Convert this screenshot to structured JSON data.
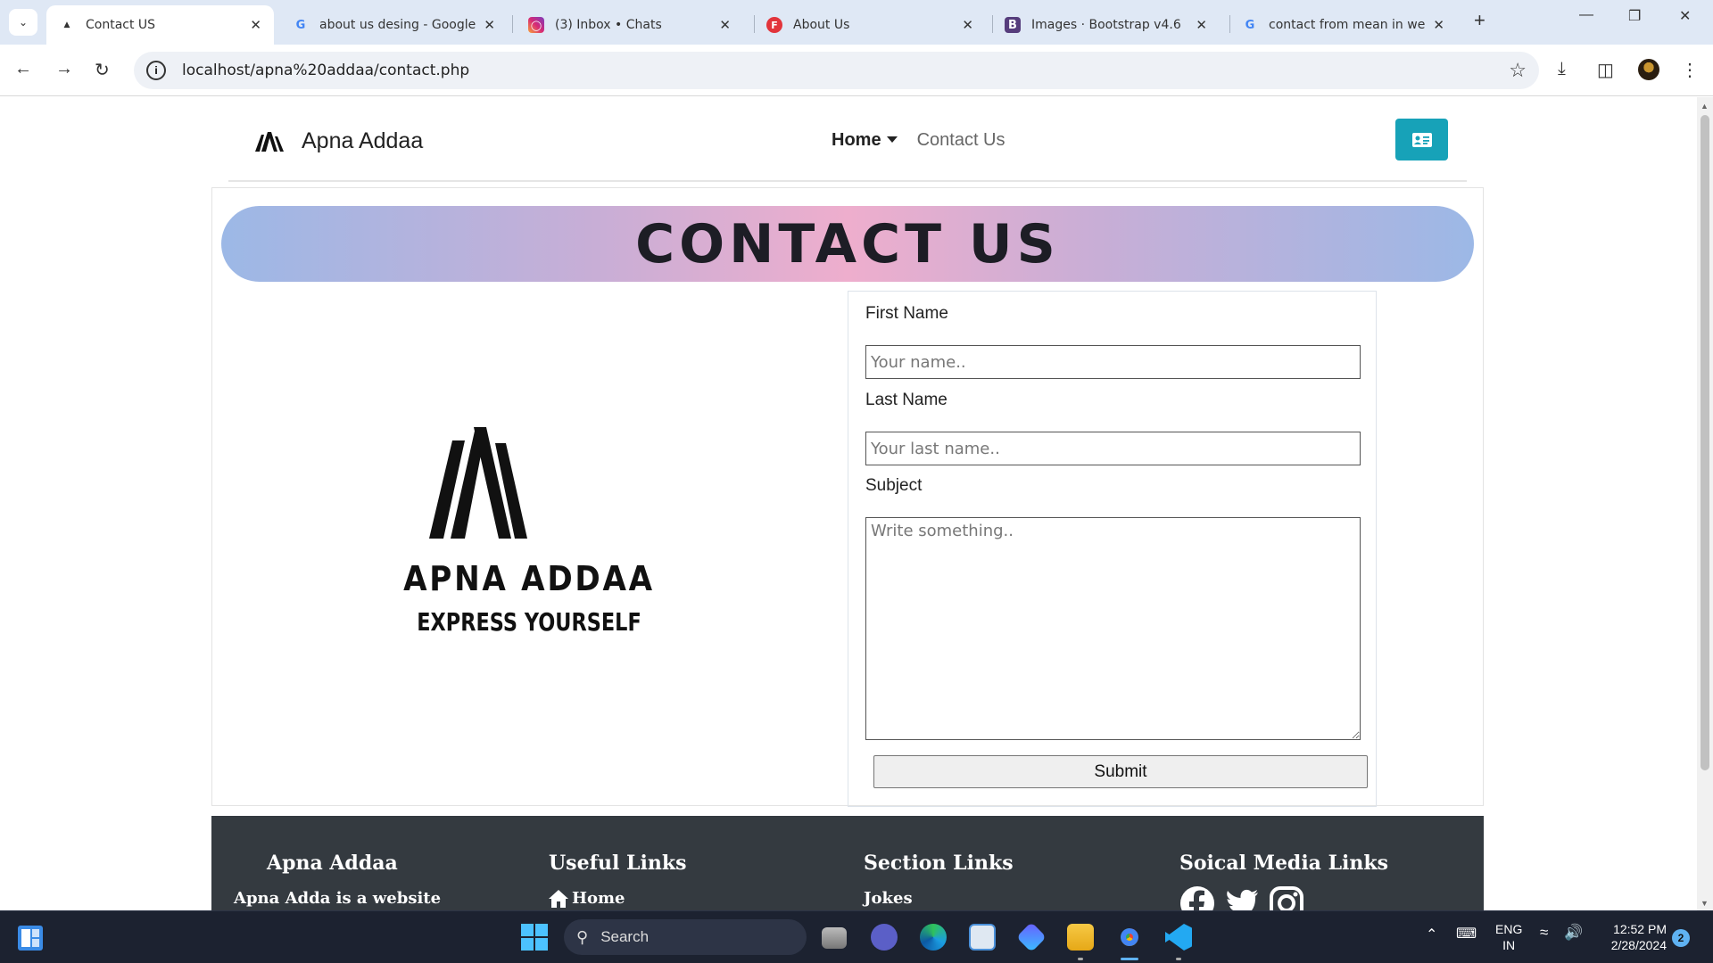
{
  "browser": {
    "tabs": [
      {
        "label": "Contact US",
        "icon": "apna-addaa-favicon",
        "active": true
      },
      {
        "label": "about us desing - Google Search",
        "icon": "google-icon"
      },
      {
        "label": "(3) Inbox • Chats",
        "icon": "instagram-icon"
      },
      {
        "label": "About Us",
        "icon": "f-favicon"
      },
      {
        "label": "Images · Bootstrap v4.6",
        "icon": "bootstrap-icon"
      },
      {
        "label": "contact from mean in web",
        "icon": "google-icon"
      }
    ],
    "url": "localhost/apna%20addaa/contact.php"
  },
  "navbar": {
    "brand": "Apna Addaa",
    "links": {
      "home": "Home",
      "contact": "Contact Us"
    },
    "button_icon": "id-card-icon"
  },
  "banner": {
    "title": "CONTACT US"
  },
  "logo": {
    "line1": "APNA ADDAA",
    "line2": "EXPRESS YOURSELF"
  },
  "form": {
    "first_name_label": "First Name",
    "first_name_placeholder": "Your name..",
    "last_name_label": "Last Name",
    "last_name_placeholder": "Your last name..",
    "subject_label": "Subject",
    "subject_placeholder": "Write something..",
    "submit_label": "Submit"
  },
  "footer": {
    "col1": {
      "title": "Apna Addaa",
      "text": "Apna Adda is a website"
    },
    "col2": {
      "title": "Useful Links",
      "text": "Home"
    },
    "col3": {
      "title": "Section Links",
      "text": "Jokes"
    },
    "col4": {
      "title": "Soical Media Links",
      "icons": [
        "facebook-icon",
        "twitter-icon",
        "instagram-icon"
      ]
    }
  },
  "taskbar": {
    "search_label": "Search",
    "lang": "ENG",
    "region": "IN",
    "time": "12:52 PM",
    "date": "2/28/2024",
    "notifications": "2"
  }
}
